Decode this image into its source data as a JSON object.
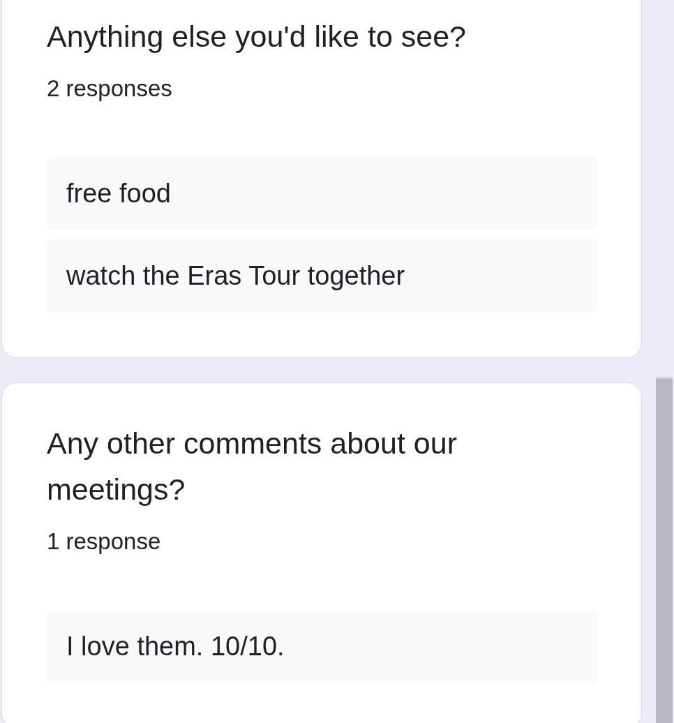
{
  "questions": [
    {
      "title": "Anything else you'd like to see?",
      "response_count": "2 responses",
      "responses": [
        "free food",
        "watch the Eras Tour together"
      ]
    },
    {
      "title": "Any other comments about our meetings?",
      "response_count": "1 response",
      "responses": [
        "I love them. 10/10."
      ]
    }
  ]
}
